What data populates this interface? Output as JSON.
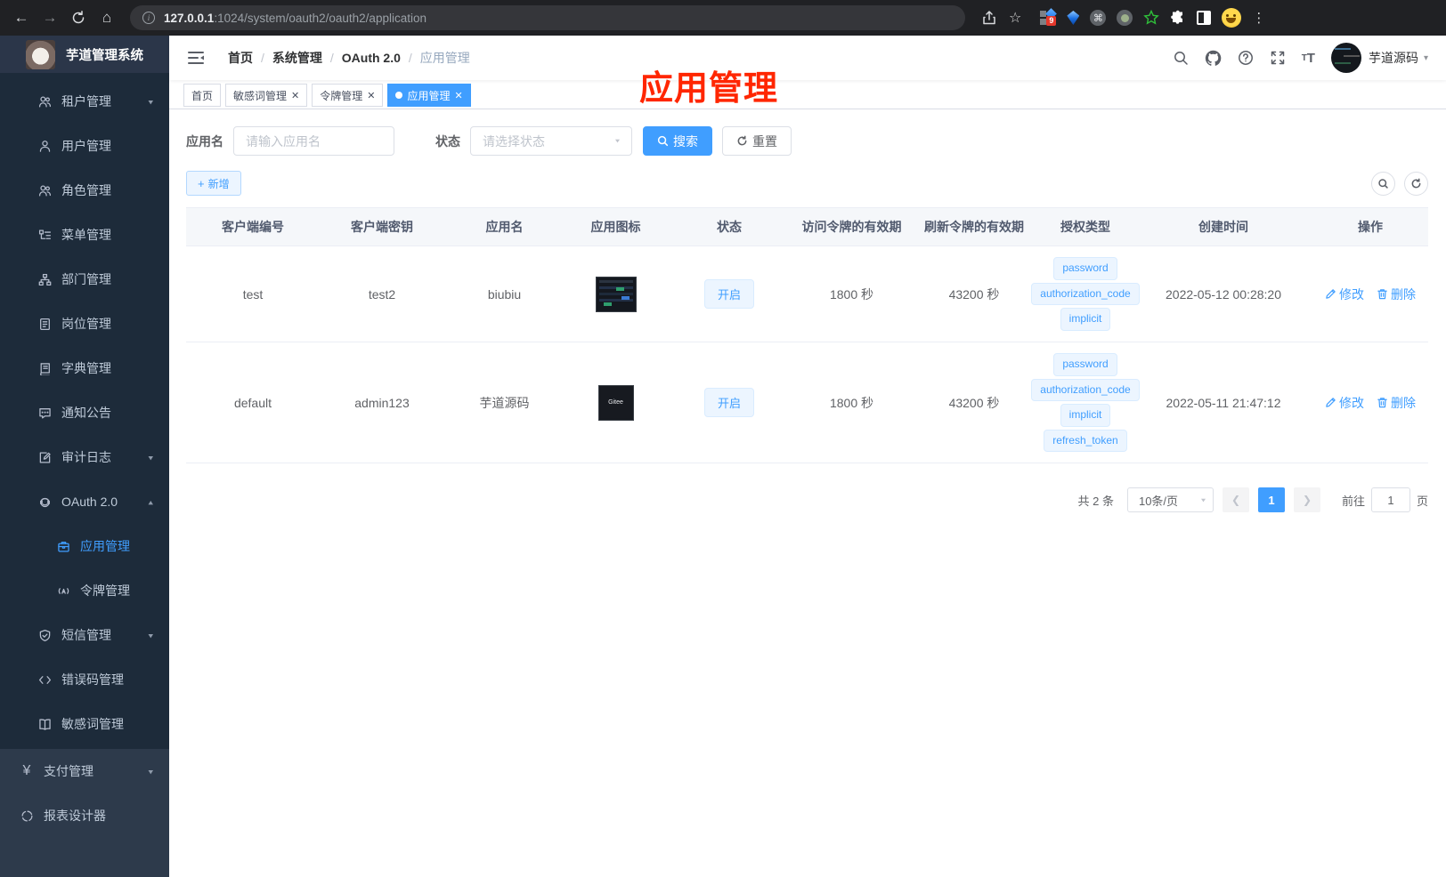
{
  "browser": {
    "url_host": "127.0.0.1",
    "url_path": ":1024/system/oauth2/oauth2/application",
    "extension_badge": "9"
  },
  "sidebar": {
    "app_title": "芋道管理系统",
    "menu": [
      {
        "label": "租户管理",
        "icon": "users-icon",
        "arrow": "down"
      },
      {
        "label": "用户管理",
        "icon": "user-icon"
      },
      {
        "label": "角色管理",
        "icon": "users-icon"
      },
      {
        "label": "菜单管理",
        "icon": "tree-table-icon"
      },
      {
        "label": "部门管理",
        "icon": "org-tree-icon"
      },
      {
        "label": "岗位管理",
        "icon": "post-badge-icon"
      },
      {
        "label": "字典管理",
        "icon": "dictionary-icon"
      },
      {
        "label": "通知公告",
        "icon": "message-icon"
      },
      {
        "label": "审计日志",
        "icon": "log-icon",
        "arrow": "down"
      },
      {
        "label": "OAuth 2.0",
        "icon": "auth-icon",
        "arrow": "up"
      },
      {
        "label": "应用管理",
        "icon": "briefcase-icon",
        "active": true
      },
      {
        "label": "令牌管理",
        "icon": "token-icon"
      },
      {
        "label": "短信管理",
        "icon": "shield-icon",
        "arrow": "down"
      },
      {
        "label": "错误码管理",
        "icon": "code-icon"
      },
      {
        "label": "敏感词管理",
        "icon": "open-book-icon"
      },
      {
        "label": "支付管理",
        "icon": "yen-icon",
        "arrow": "down"
      },
      {
        "label": "报表设计器",
        "icon": "report-icon"
      }
    ]
  },
  "header": {
    "breadcrumbs": [
      "首页",
      "系统管理",
      "OAuth 2.0",
      "应用管理"
    ],
    "user_name": "芋道源码"
  },
  "tabs": [
    {
      "label": "首页"
    },
    {
      "label": "敏感词管理"
    },
    {
      "label": "令牌管理"
    },
    {
      "label": "应用管理",
      "active": true
    }
  ],
  "annotation": "应用管理",
  "filters": {
    "name_label": "应用名",
    "name_placeholder": "请输入应用名",
    "status_label": "状态",
    "status_placeholder": "请选择状态",
    "search_label": "搜索",
    "reset_label": "重置"
  },
  "toolbar": {
    "add_label": "新增"
  },
  "table": {
    "headers": [
      "客户端编号",
      "客户端密钥",
      "应用名",
      "应用图标",
      "状态",
      "访问令牌的有效期",
      "刷新令牌的有效期",
      "授权类型",
      "创建时间",
      "操作"
    ],
    "edit_label": "修改",
    "delete_label": "删除",
    "rows": [
      {
        "client_id": "test",
        "client_secret": "test2",
        "name": "biubiu",
        "status": "开启",
        "access_token_ttl": "1800 秒",
        "refresh_token_ttl": "43200 秒",
        "grant_types": [
          "password",
          "authorization_code",
          "implicit"
        ],
        "created_at": "2022-05-12 00:28:20"
      },
      {
        "client_id": "default",
        "client_secret": "admin123",
        "name": "芋道源码",
        "icon_text": "Gitee",
        "status": "开启",
        "access_token_ttl": "1800 秒",
        "refresh_token_ttl": "43200 秒",
        "grant_types": [
          "password",
          "authorization_code",
          "implicit",
          "refresh_token"
        ],
        "created_at": "2022-05-11 21:47:12"
      }
    ]
  },
  "pagination": {
    "total_label": "共 2 条",
    "page_size_label": "10条/页",
    "current_page": "1",
    "goto_label": "前往",
    "goto_value": "1",
    "page_suffix": "页"
  }
}
